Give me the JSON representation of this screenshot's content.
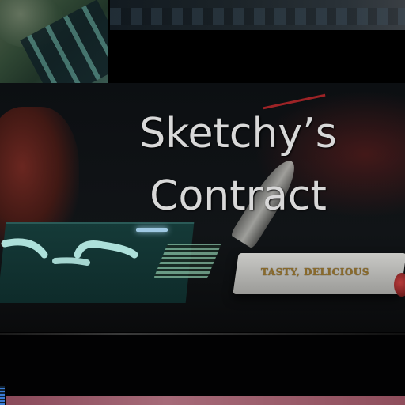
{
  "title": {
    "line1": "Sketchy’s",
    "line2": "Contract"
  },
  "scene": {
    "plaque_text": "TASTY, DELICIOUS"
  },
  "colors": {
    "title_text": "#d8d8d8",
    "background": "#000000",
    "screen_glow": "#9fe8e0",
    "plaque": "#b0b0ad",
    "plaque_text": "#8a6a2a"
  }
}
